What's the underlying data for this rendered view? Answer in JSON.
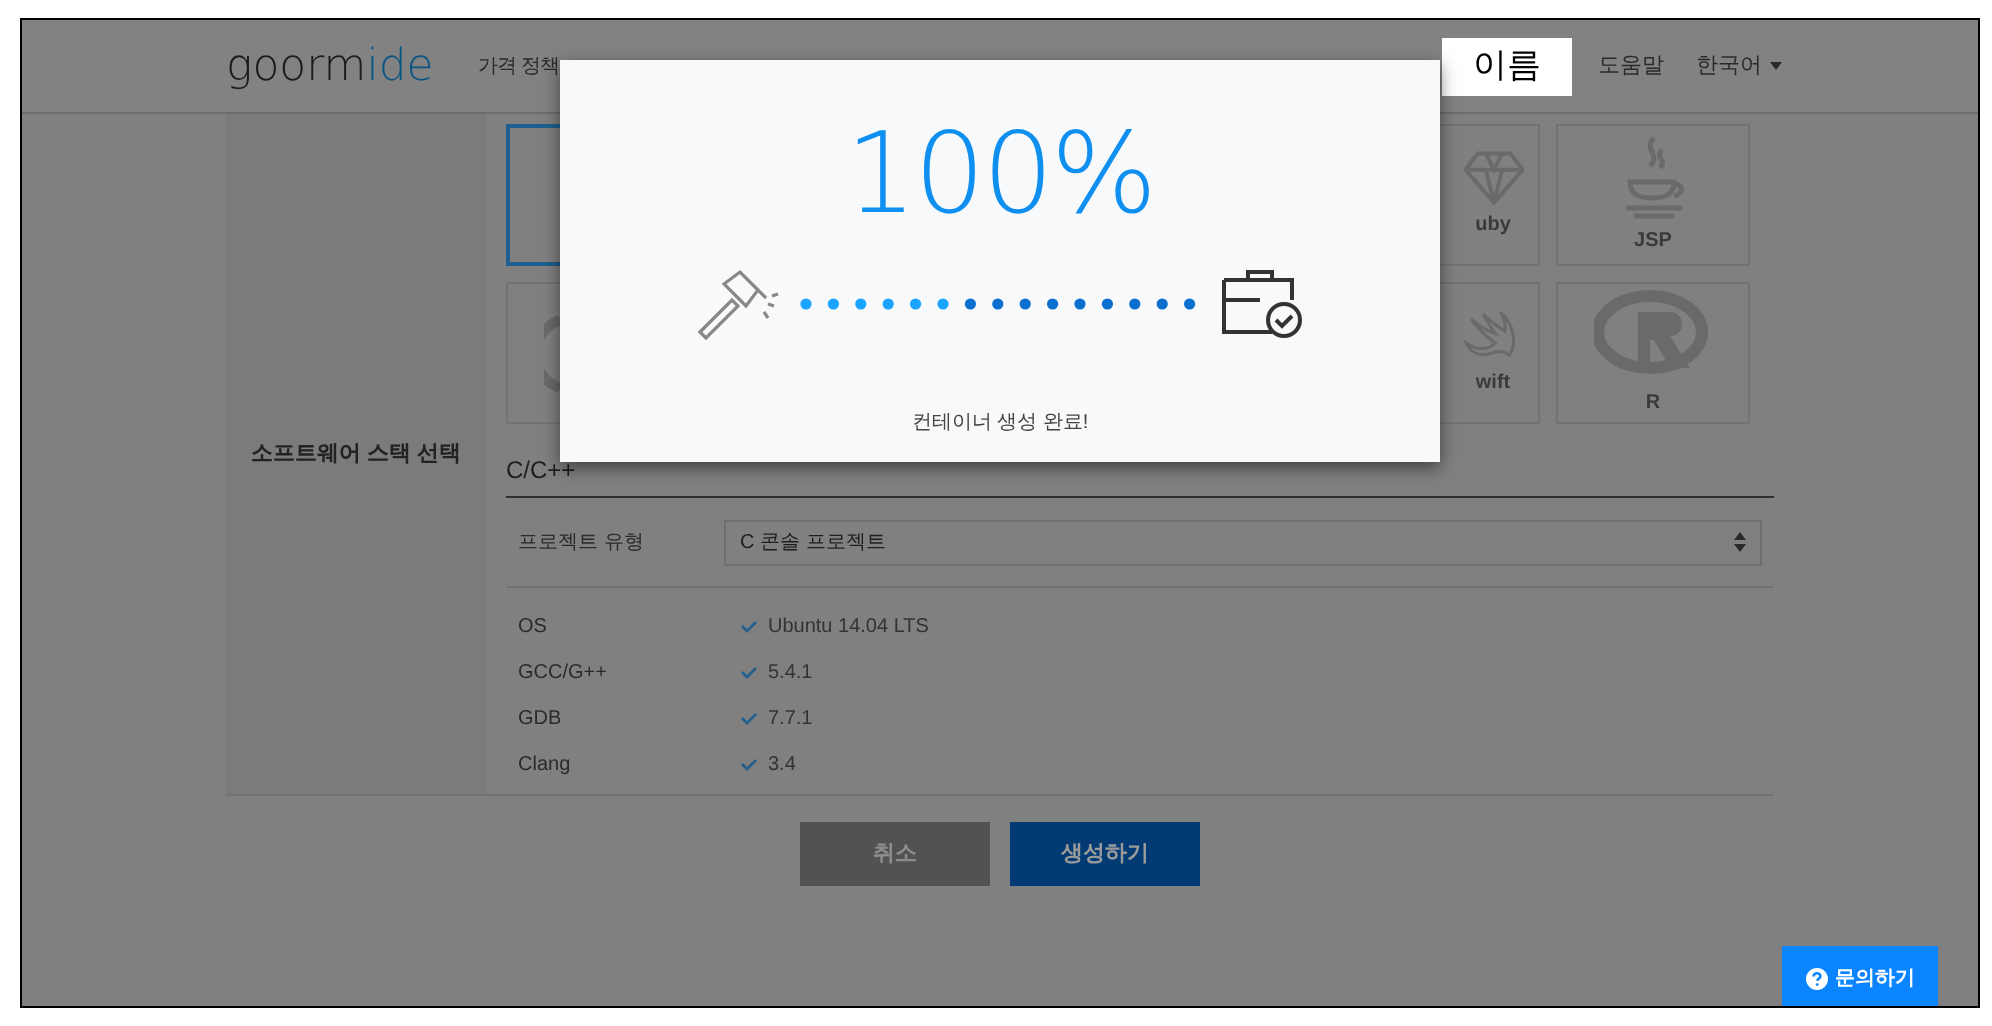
{
  "header": {
    "logo_main": "goorm",
    "logo_accent": "ide",
    "nav": [
      "가격 정책"
    ],
    "user_name": "이름",
    "help": "도움말",
    "language": "한국어"
  },
  "stack": {
    "label": "소프트웨어 스택 선택",
    "rows": [
      [
        {
          "kind": "blank",
          "selected": true
        },
        {
          "kind": "gem",
          "label": "uby",
          "selected": false
        },
        {
          "kind": "cup",
          "label": "JSP",
          "selected": false
        }
      ],
      [
        {
          "kind": "circle",
          "selected": false
        },
        {
          "kind": "bird",
          "label": "wift",
          "selected": false
        },
        {
          "kind": "rlogo",
          "label": "R",
          "selected": false
        }
      ]
    ],
    "section_title": "C/C++",
    "project_type": {
      "label": "프로젝트 유형",
      "value": "C 콘솔 프로젝트"
    },
    "specs": [
      {
        "name": "OS",
        "value": "Ubuntu 14.04 LTS",
        "checked": true
      },
      {
        "name": "GCC/G++",
        "value": "5.4.1",
        "checked": true
      },
      {
        "name": "GDB",
        "value": "7.7.1",
        "checked": true
      },
      {
        "name": "Clang",
        "value": "3.4",
        "checked": true
      }
    ]
  },
  "buttons": {
    "cancel": "취소",
    "create": "생성하기"
  },
  "modal": {
    "percent": "100%",
    "message": "컨테이너 생성 완료!"
  },
  "contact": "문의하기"
}
